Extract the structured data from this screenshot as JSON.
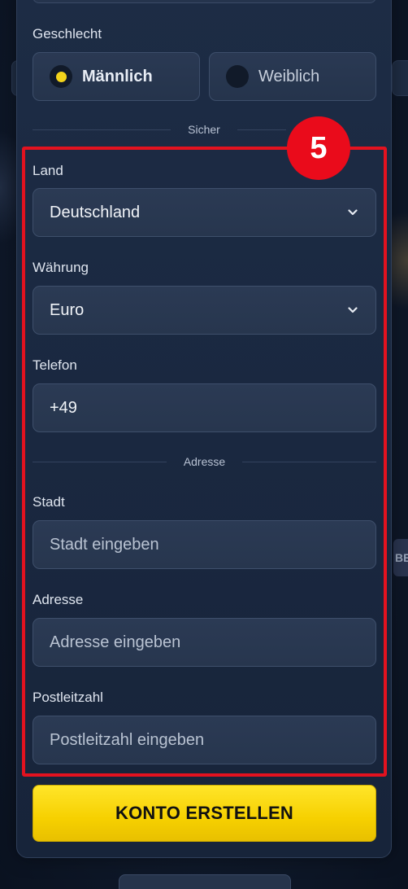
{
  "gender": {
    "label": "Geschlecht",
    "options": [
      {
        "label": "Männlich",
        "selected": true
      },
      {
        "label": "Weiblich",
        "selected": false
      }
    ]
  },
  "section_secure": "Sicher",
  "step_number": "5",
  "country": {
    "label": "Land",
    "value": "Deutschland"
  },
  "currency": {
    "label": "Währung",
    "value": "Euro"
  },
  "phone": {
    "label": "Telefon",
    "value": "+49"
  },
  "section_address": "Adresse",
  "city": {
    "label": "Stadt",
    "placeholder": "Stadt eingeben"
  },
  "address": {
    "label": "Adresse",
    "placeholder": "Adresse eingeben"
  },
  "postal": {
    "label": "Postleitzahl",
    "placeholder": "Postleitzahl eingeben"
  },
  "submit_label": "KONTO ERSTELLEN",
  "colors": {
    "accent_yellow": "#f6d000",
    "highlight_red": "#e3121f",
    "panel_bg": "#1a2840"
  }
}
